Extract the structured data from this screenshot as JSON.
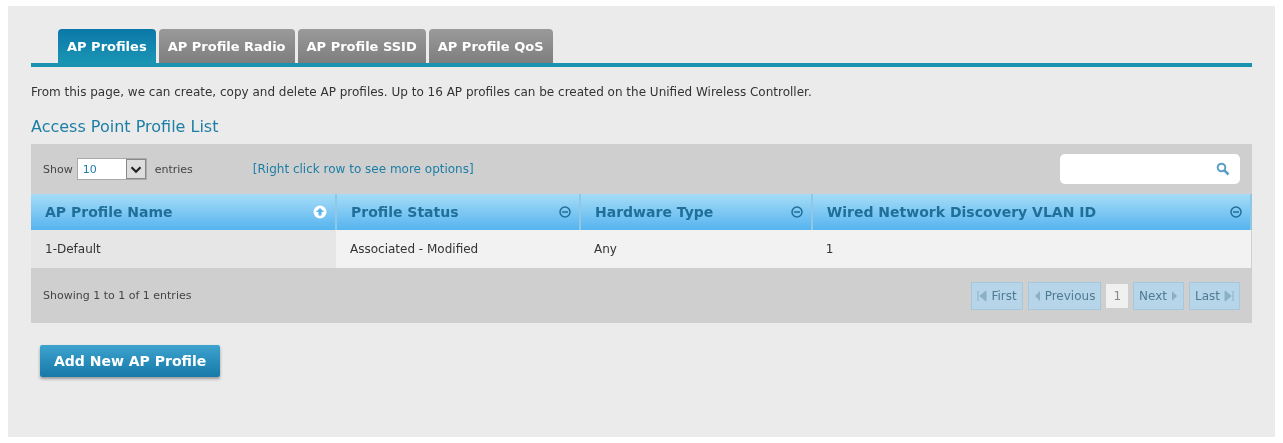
{
  "tabs": [
    {
      "label": "AP Profiles",
      "selected": true
    },
    {
      "label": "AP Profile Radio",
      "selected": false
    },
    {
      "label": "AP Profile SSID",
      "selected": false
    },
    {
      "label": "AP Profile QoS",
      "selected": false
    }
  ],
  "description": "From this page, we can create, copy and delete AP profiles. Up to 16 AP profiles can be created on the Unified Wireless Controller.",
  "section_title": "Access Point Profile List",
  "table": {
    "show_label": "Show",
    "page_size": "10",
    "entries_label": "entries",
    "hint": "[Right click row to see more options]",
    "columns": [
      {
        "label": "AP Profile Name",
        "sorted": true
      },
      {
        "label": "Profile Status",
        "sorted": false
      },
      {
        "label": "Hardware Type",
        "sorted": false
      },
      {
        "label": "Wired Network Discovery VLAN ID",
        "sorted": false
      }
    ],
    "rows": [
      [
        "1-Default",
        "Associated - Modified",
        "Any",
        "1"
      ]
    ],
    "info": "Showing 1 to 1 of 1 entries",
    "pagination": [
      {
        "kind": "first",
        "label": "First",
        "disabled": true
      },
      {
        "kind": "previous",
        "label": "Previous",
        "disabled": true
      },
      {
        "kind": "page",
        "label": "1",
        "selected": true
      },
      {
        "kind": "next",
        "label": "Next",
        "disabled": true
      },
      {
        "kind": "last",
        "label": "Last",
        "disabled": true
      }
    ]
  },
  "add_button": "Add New AP Profile"
}
